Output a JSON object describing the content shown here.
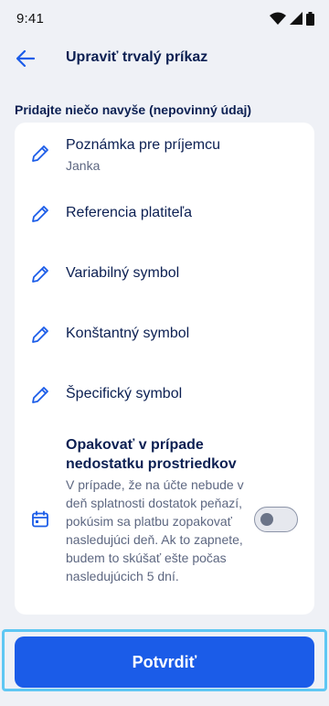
{
  "status_bar": {
    "time": "9:41"
  },
  "header": {
    "title": "Upraviť trvalý príkaz"
  },
  "section": {
    "label": "Pridajte niečo navyše (nepovinný údaj)"
  },
  "items": [
    {
      "title": "Poznámka pre príjemcu",
      "value": "Janka",
      "icon": "pencil-icon"
    },
    {
      "title": "Referencia platiteľa",
      "value": "",
      "icon": "pencil-icon"
    },
    {
      "title": "Variabilný symbol",
      "value": "",
      "icon": "pencil-icon"
    },
    {
      "title": "Konštantný symbol",
      "value": "",
      "icon": "pencil-icon"
    },
    {
      "title": "Špecifický symbol",
      "value": "",
      "icon": "pencil-icon"
    }
  ],
  "repeat": {
    "title": "Opakovať v prípade nedostatku prostriedkov",
    "description": "V prípade, že na účte nebude v deň splatnosti dostatok peňazí, pokúsim sa platbu zopakovať nasledujúci deň. Ak to zapnete, budem to skúšať ešte počas nasledujúcich 5 dní.",
    "enabled": false,
    "icon": "calendar-icon"
  },
  "footer": {
    "confirm_label": "Potvrdiť"
  },
  "colors": {
    "primary": "#1b5ce8",
    "text": "#0b1f52",
    "background": "#eff1f6",
    "focus": "#5fc7f3"
  }
}
